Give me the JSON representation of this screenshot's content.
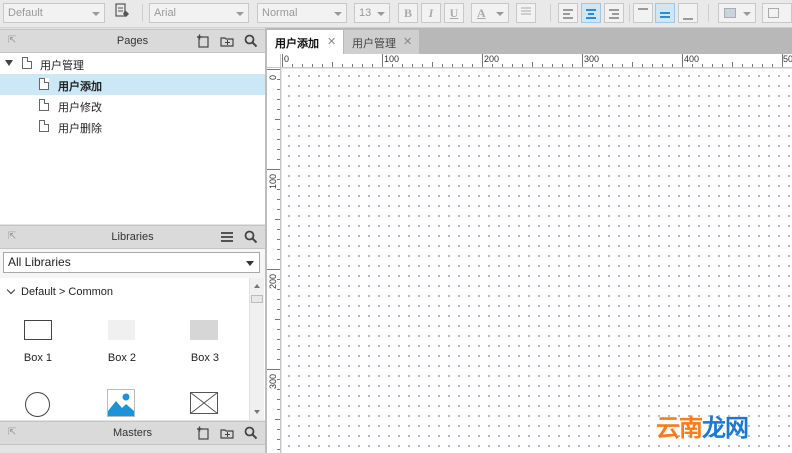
{
  "toolbar": {
    "style_select": "Default",
    "font_select": "Arial",
    "weight_select": "Normal",
    "size_select": "13",
    "bold_label": "B",
    "italic_label": "I",
    "underline_label": "U",
    "font_color_label": "A"
  },
  "pages": {
    "title": "Pages",
    "items": [
      {
        "label": "用户管理",
        "level": 0,
        "selected": false
      },
      {
        "label": "用户添加",
        "level": 1,
        "selected": true
      },
      {
        "label": "用户修改",
        "level": 1,
        "selected": false
      },
      {
        "label": "用户删除",
        "level": 1,
        "selected": false
      }
    ]
  },
  "libraries": {
    "title": "Libraries",
    "select_value": "All Libraries",
    "breadcrumb": "Default > Common",
    "widgets": [
      {
        "label": "Box 1"
      },
      {
        "label": "Box 2"
      },
      {
        "label": "Box 3"
      },
      {
        "label": ""
      },
      {
        "label": ""
      },
      {
        "label": ""
      }
    ]
  },
  "masters": {
    "title": "Masters"
  },
  "tabs": [
    {
      "label": "用户添加",
      "active": true
    },
    {
      "label": "用户管理",
      "active": false
    }
  ],
  "ruler": {
    "top": [
      "0",
      "100",
      "200",
      "300",
      "400",
      "50"
    ],
    "left": [
      "0",
      "100",
      "200",
      "300"
    ]
  },
  "watermark": {
    "part1": "云南",
    "part2": "龙网"
  },
  "colors": {
    "selection": "#cce8f6",
    "accent": "#2a8dd4",
    "watermark_orange": "#ff7a1a",
    "watermark_blue": "#1a77d2"
  }
}
